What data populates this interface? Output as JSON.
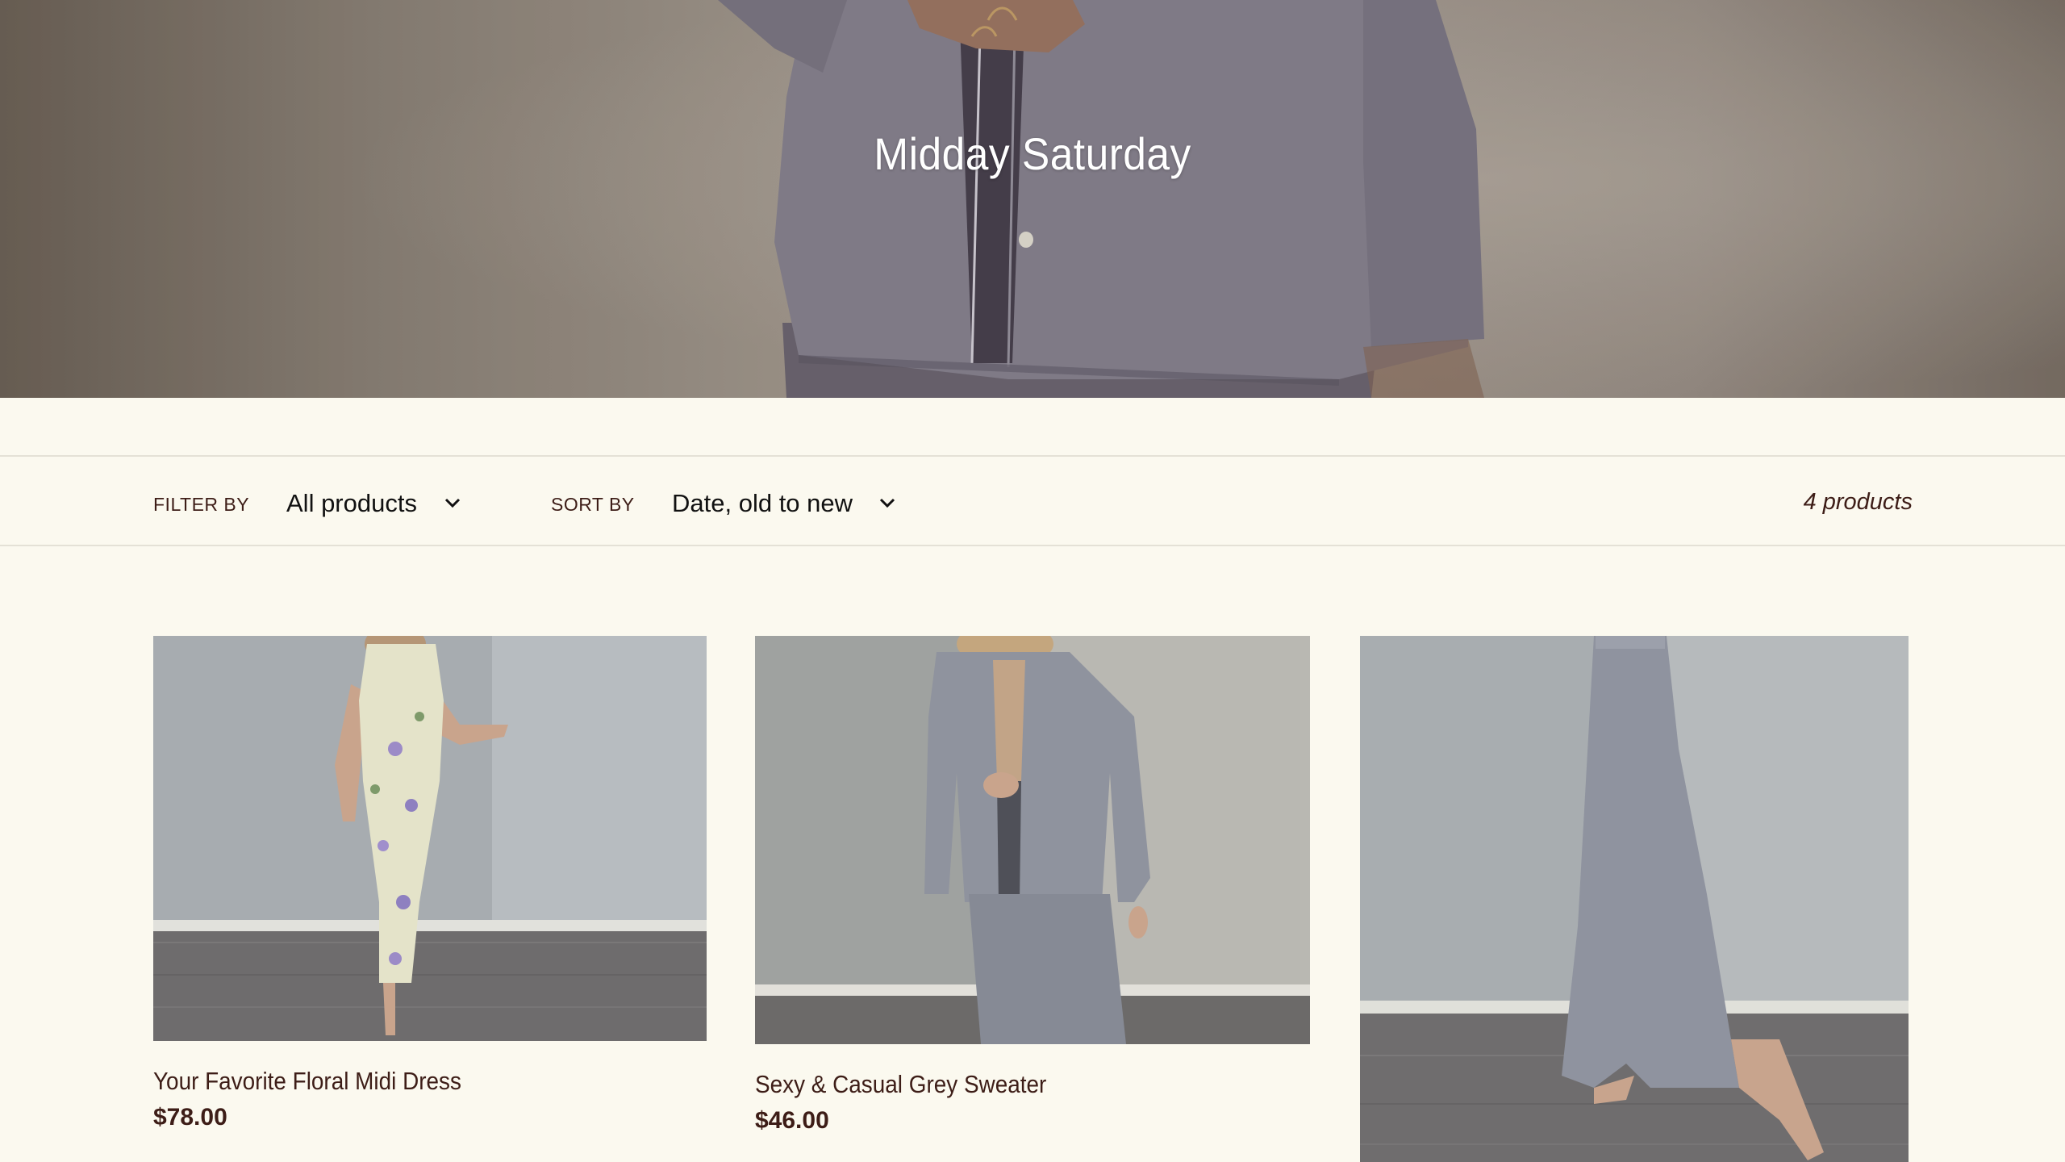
{
  "collection": {
    "title": "Midday Saturday"
  },
  "filter": {
    "label": "FILTER BY",
    "selected": "All products"
  },
  "sort": {
    "label": "SORT BY",
    "selected": "Date, old to new"
  },
  "product_count": "4 products",
  "products": [
    {
      "title": "Your Favorite Floral Midi Dress",
      "price": "$78.00"
    },
    {
      "title": "Sexy & Casual Grey Sweater",
      "price": "$46.00"
    },
    {
      "title": "",
      "price": ""
    }
  ]
}
